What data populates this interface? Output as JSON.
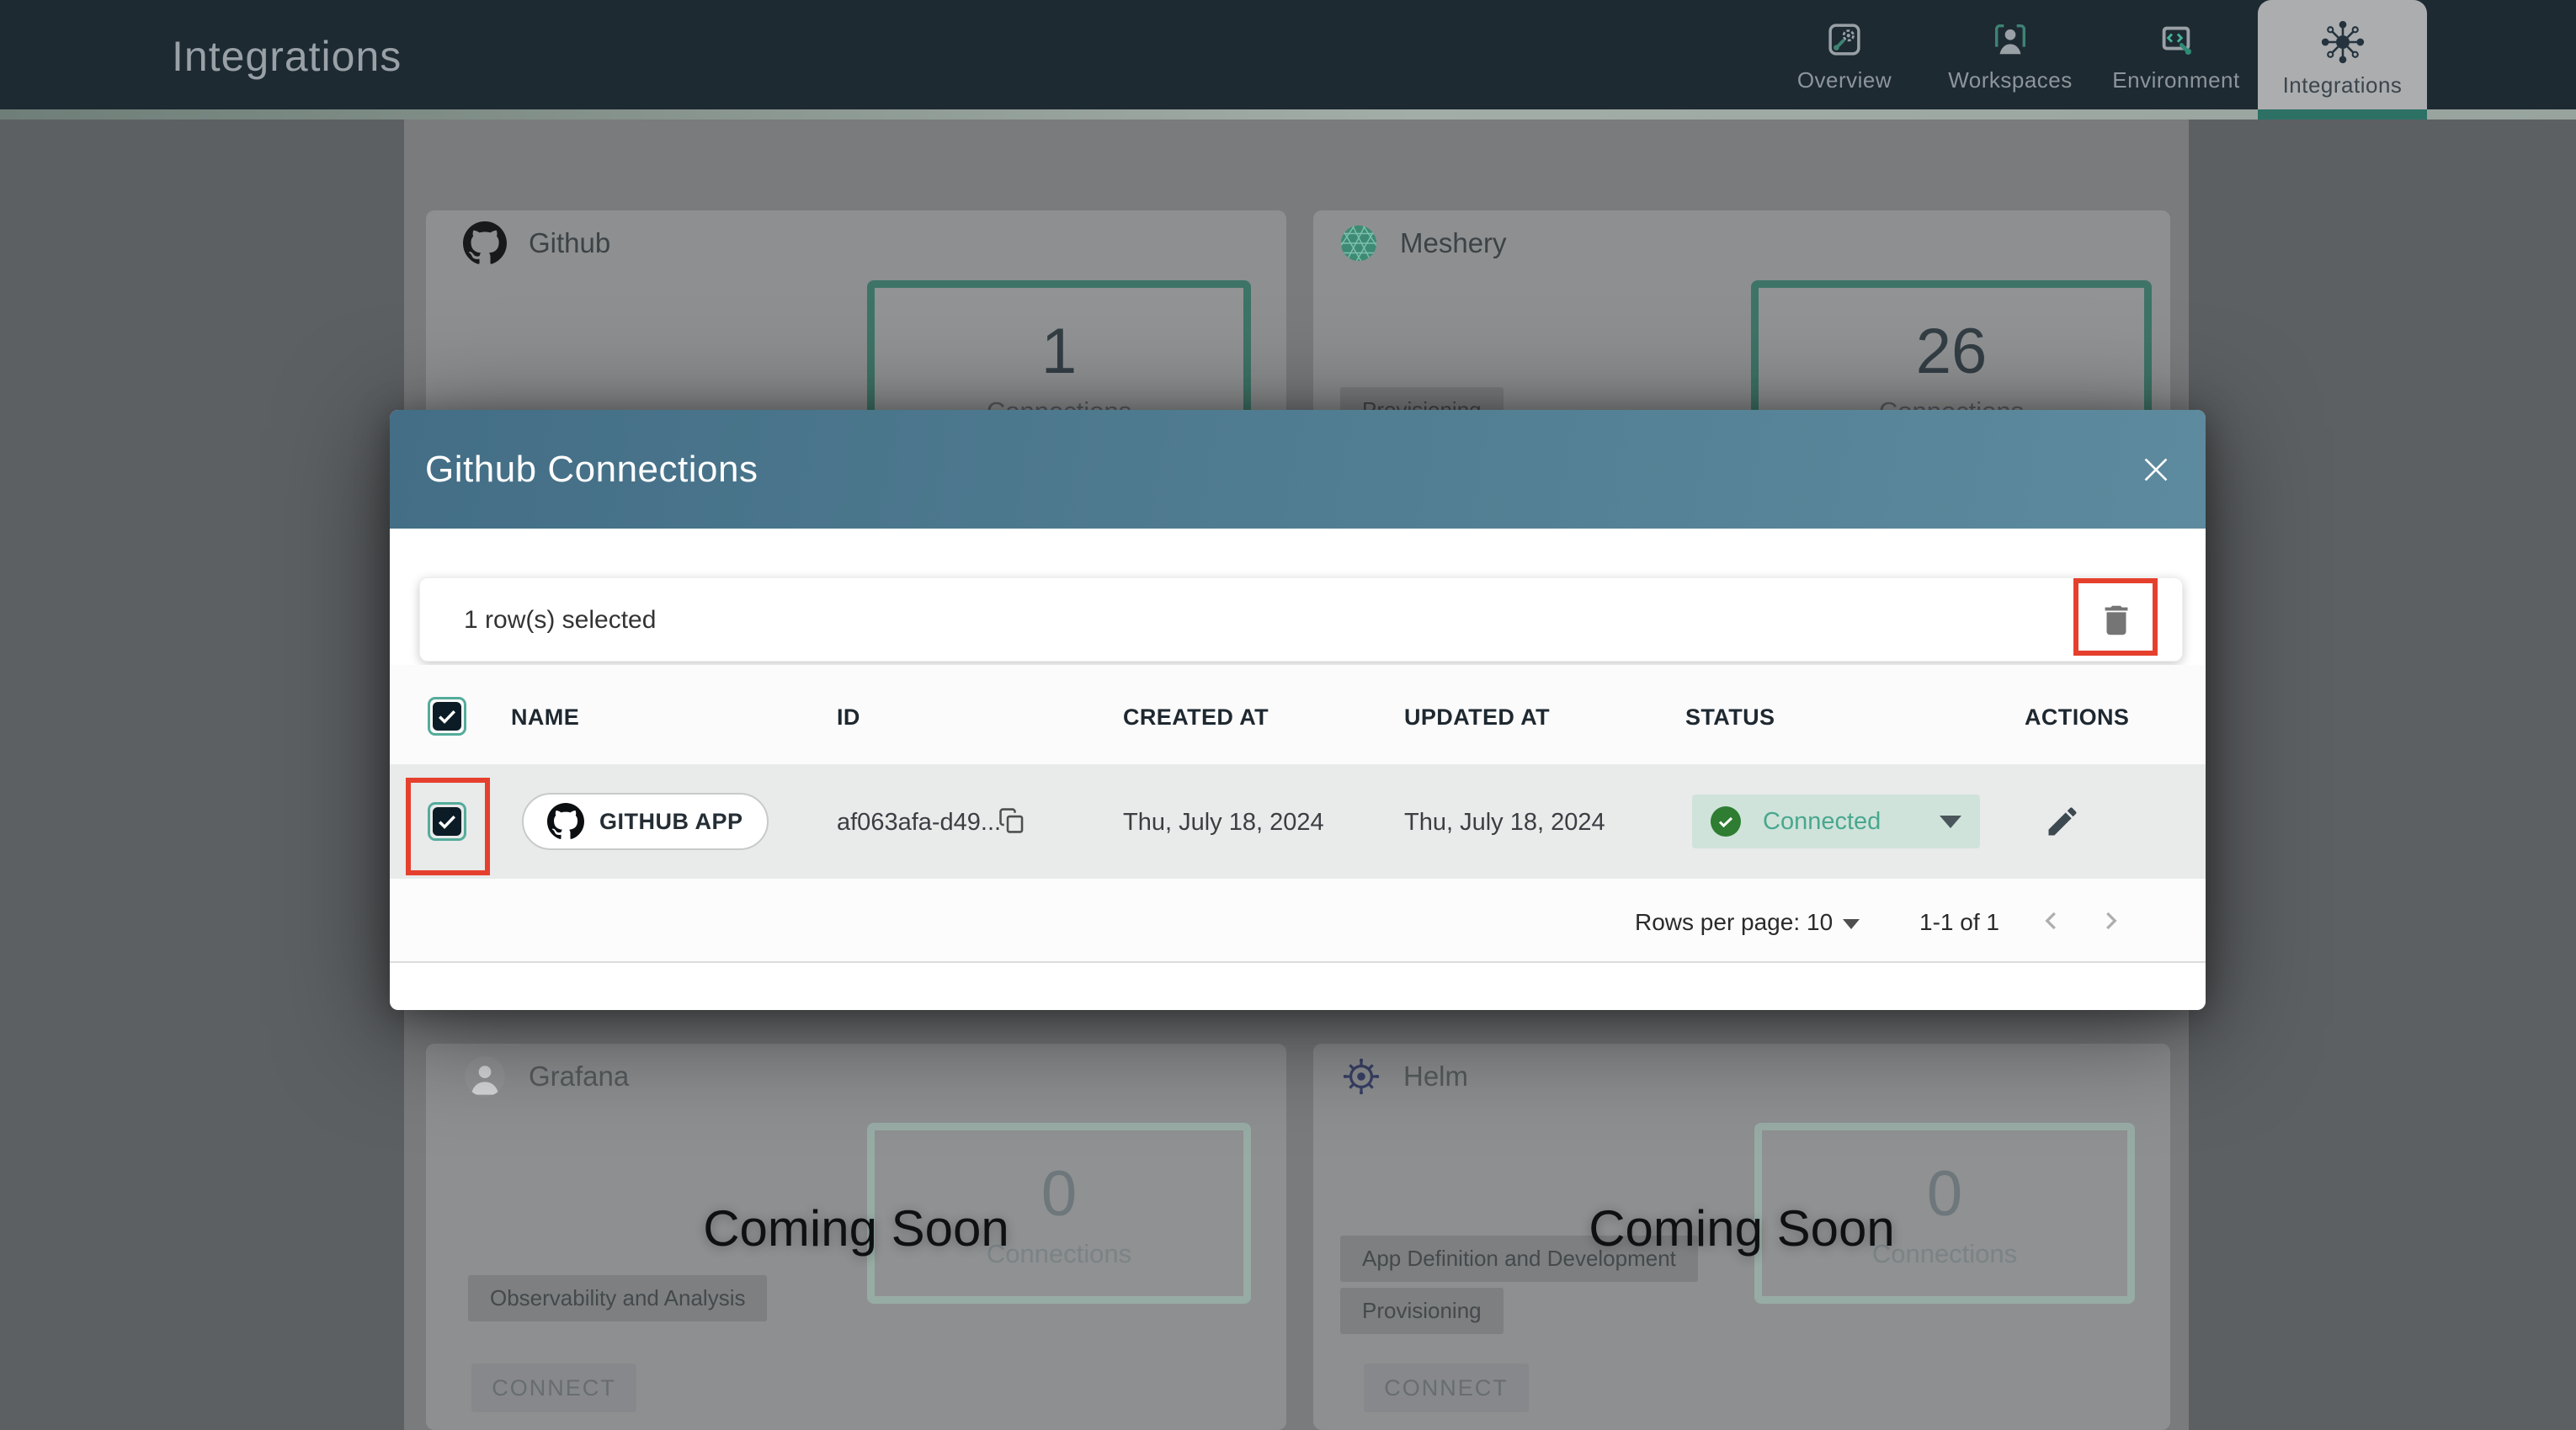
{
  "header": {
    "title": "Integrations",
    "tabs": [
      {
        "label": "Overview",
        "active": false
      },
      {
        "label": "Workspaces",
        "active": false
      },
      {
        "label": "Environment",
        "active": false
      },
      {
        "label": "Integrations",
        "active": true
      }
    ]
  },
  "cards": [
    {
      "title": "Github",
      "connections_count": "1",
      "connections_label": "Connections",
      "chips": []
    },
    {
      "title": "Meshery",
      "connections_count": "26",
      "connections_label": "Connections",
      "chips": [
        "Provisioning"
      ]
    },
    {
      "title": "Grafana",
      "connections_count": "0",
      "connections_label": "Connections",
      "chips": [
        "Observability and Analysis"
      ],
      "coming_soon": "Coming Soon",
      "connect_label": "CONNECT"
    },
    {
      "title": "Helm",
      "connections_count": "0",
      "connections_label": "Connections",
      "chips": [
        "App Definition and Development",
        "Provisioning"
      ],
      "coming_soon": "Coming Soon",
      "connect_label": "CONNECT"
    }
  ],
  "modal": {
    "title": "Github Connections",
    "selection_text": "1 row(s) selected",
    "table": {
      "columns": [
        "NAME",
        "ID",
        "CREATED AT",
        "UPDATED AT",
        "STATUS",
        "ACTIONS"
      ],
      "rows": [
        {
          "name": "GITHUB APP",
          "id": "af063afa-d49...",
          "created_at": "Thu, July 18, 2024",
          "updated_at": "Thu, July 18, 2024",
          "status": "Connected",
          "selected": true
        }
      ]
    },
    "pagination": {
      "rows_per_page_label": "Rows per page:",
      "rows_per_page_value": "10",
      "range_text": "1-1 of 1"
    }
  },
  "icons": {
    "toolbar_action": "trash-icon",
    "row_action": "edit-pencil-icon",
    "id_action": "copy-icon",
    "status_leading": "check-circle-icon"
  },
  "colors": {
    "header_bg": "#1d2a32",
    "active_tab_bg": "#abadaf",
    "tab_underline_teal": "#2c7164",
    "modal_header_gradient_start": "#436e86",
    "modal_header_gradient_end": "#5d8a9e",
    "annotation_red": "#e5402e",
    "selected_row_bg": "#e9eaea",
    "status_connected_bg": "#cfe3db",
    "status_connected_text": "#49a78d",
    "status_check_green": "#2e7d32",
    "connections_box_border_teal": "#3e7467",
    "checkbox_fill": "#0c1c27",
    "checkbox_ring_teal": "#54ac9b"
  }
}
